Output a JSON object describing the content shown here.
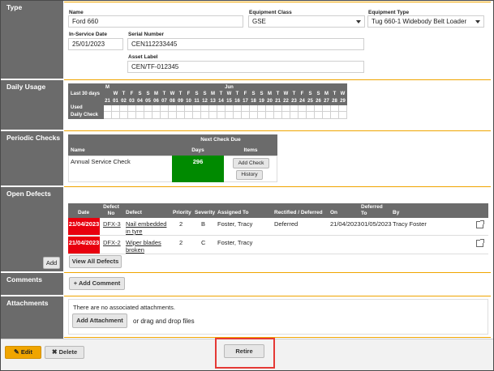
{
  "sections": {
    "type": "Type",
    "daily_usage": "Daily Usage",
    "periodic_checks": "Periodic Checks",
    "open_defects": "Open Defects",
    "comments": "Comments",
    "attachments": "Attachments"
  },
  "form": {
    "name_label": "Name",
    "name_value": "Ford 660",
    "class_label": "Equipment Class",
    "class_value": "GSE",
    "type_label": "Equipment Type",
    "type_value": "Tug 660-1 Widebody Belt Loader",
    "inservice_label": "In-Service Date",
    "inservice_value": "25/01/2023",
    "serial_label": "Serial Number",
    "serial_value": "CEN112233445",
    "asset_label": "Asset Label",
    "asset_value": "CEN/TF-012345"
  },
  "usage": {
    "last30": "Last 30 days",
    "first_day_letter": "M",
    "month": "Jun",
    "day_letters": [
      "W",
      "T",
      "F",
      "S",
      "S",
      "M",
      "T",
      "W",
      "T",
      "F",
      "S",
      "S",
      "M",
      "T",
      "W",
      "T",
      "F",
      "S",
      "S",
      "M",
      "T",
      "W",
      "T",
      "F",
      "S",
      "S",
      "M",
      "T",
      "W"
    ],
    "day_numbers": [
      "21",
      "01",
      "02",
      "03",
      "04",
      "05",
      "06",
      "07",
      "08",
      "09",
      "10",
      "11",
      "12",
      "13",
      "14",
      "15",
      "16",
      "17",
      "18",
      "19",
      "20",
      "21",
      "22",
      "23",
      "24",
      "25",
      "26",
      "27",
      "28",
      "29"
    ],
    "rows": [
      "Used",
      "Daily Check"
    ]
  },
  "periodic": {
    "header": "Next Check Due",
    "col_name": "Name",
    "col_days": "Days",
    "col_items": "Items",
    "check_name": "Annual Service Check",
    "days": "296",
    "add_check": "Add Check",
    "history": "History"
  },
  "defects": {
    "headers": {
      "date": "Date",
      "defect_no": "Defect No",
      "defect": "Defect",
      "priority": "Priority",
      "severity": "Severity",
      "assigned": "Assigned To",
      "rect": "Rectified / Deferred",
      "on": "On",
      "deferred_to": "Deferred To",
      "by": "By"
    },
    "rows": [
      {
        "date": "21/04/2023",
        "no": "DFX-3",
        "defect": "Nail embedded in tyre",
        "priority": "2",
        "severity": "B",
        "assigned": "Foster, Tracy",
        "rect": "Deferred",
        "on": "21/04/2023",
        "deferred_to": "01/05/2023",
        "by": "Tracy Foster"
      },
      {
        "date": "21/04/2023",
        "no": "DFX-2",
        "defect": "Wiper blades broken",
        "priority": "2",
        "severity": "C",
        "assigned": "Foster, Tracy",
        "rect": "",
        "on": "",
        "deferred_to": "",
        "by": ""
      }
    ],
    "add": "Add",
    "view_all": "View All Defects"
  },
  "comments": {
    "add": "+ Add Comment"
  },
  "attachments": {
    "none": "There are no associated attachments.",
    "add": "Add Attachment",
    "drag": "or drag and drop files"
  },
  "footer": {
    "edit": "Edit",
    "delete": "Delete",
    "retire": "Retire"
  },
  "colors": {
    "label_bg": "#6b6b6b",
    "accent": "#f0a500",
    "red": "#e8000e",
    "green": "#008a00",
    "highlight": "#e53935"
  }
}
